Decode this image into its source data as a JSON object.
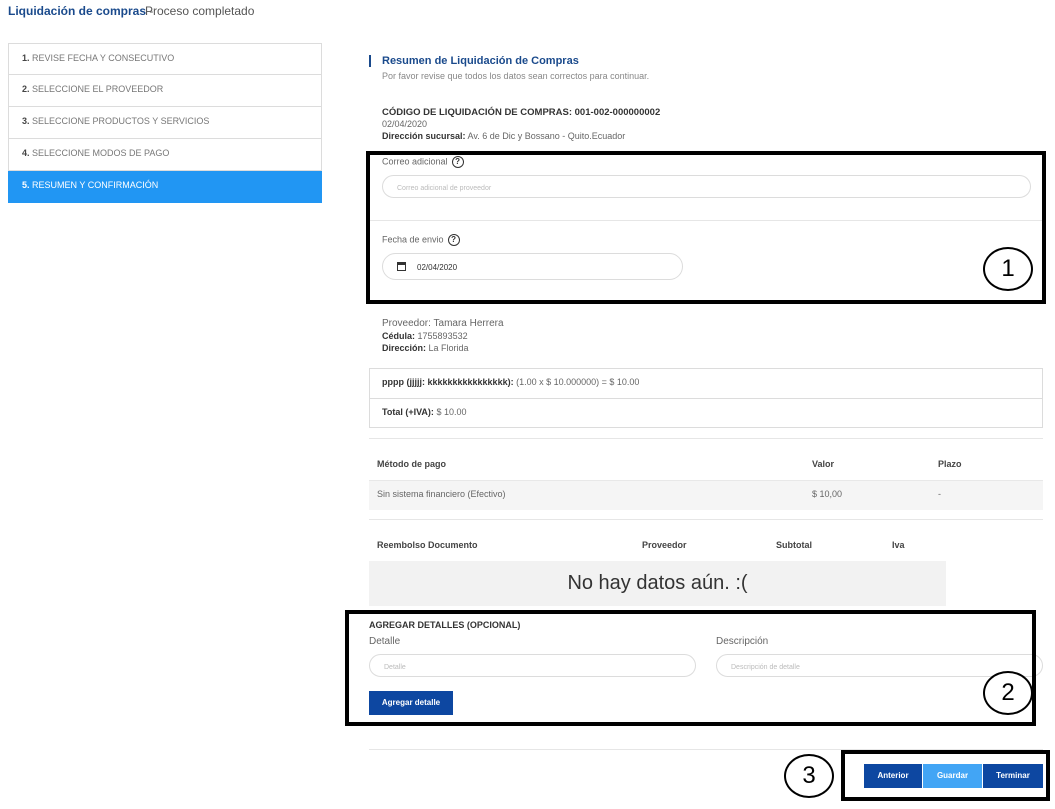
{
  "header": {
    "title": "Liquidación de compras",
    "subtitle": "Proceso completado",
    "separator": " - "
  },
  "steps": [
    {
      "num": "1.",
      "label": "REVISE FECHA Y CONSECUTIVO"
    },
    {
      "num": "2.",
      "label": "SELECCIONE EL PROVEEDOR"
    },
    {
      "num": "3.",
      "label": "SELECCIONE PRODUCTOS Y SERVICIOS"
    },
    {
      "num": "4.",
      "label": "SELECCIONE MODOS DE PAGO"
    },
    {
      "num": "5.",
      "label": "RESUMEN Y CONFIRMACIÓN",
      "active": true
    }
  ],
  "summary": {
    "title": "Resumen de Liquidación de Compras",
    "subtitle": "Por favor revise que todos los datos sean correctos para continuar.",
    "code": "CÓDIGO DE LIQUIDACIÓN DE COMPRAS: 001-002-000000002",
    "date": "02/04/2020",
    "branch_label": "Dirección sucursal:",
    "branch_value": "Av. 6 de Dic y Bossano - Quito.Ecuador"
  },
  "email": {
    "label": "Correo adicional",
    "help": "?",
    "placeholder": "Correo adicional de proveedor"
  },
  "send_date": {
    "label": "Fecha de envio",
    "help": "?",
    "value": "02/04/2020"
  },
  "provider": {
    "name_line": "Proveedor: Tamara Herrera",
    "id_label": "Cédula:",
    "id_value": "1755893532",
    "address_label": "Dirección:",
    "address_value": "La Florida"
  },
  "items": {
    "line_label": "pppp (jjjjj: kkkkkkkkkkkkkkkk):",
    "line_value": "(1.00 x $ 10.000000) = $ 10.00",
    "total_label": "Total (+IVA):",
    "total_value": "$ 10.00"
  },
  "payments": {
    "headers": [
      "Método de pago",
      "Valor",
      "Plazo"
    ],
    "rows": [
      [
        "Sin sistema financiero (Efectivo)",
        "$ 10,00",
        "-"
      ]
    ]
  },
  "reimbursement": {
    "headers": [
      "Reembolso Documento",
      "Proveedor",
      "Subtotal",
      "Iva"
    ],
    "empty": "No hay datos aún. :("
  },
  "details": {
    "title": "AGREGAR DETALLES (OPCIONAL)",
    "detail_label": "Detalle",
    "detail_placeholder": "Detalle",
    "desc_label": "Descripción",
    "desc_placeholder": "Descripción de detalle",
    "add_button": "Agregar detalle"
  },
  "nav": {
    "prev": "Anterior",
    "save": "Guardar",
    "finish": "Terminar"
  },
  "callouts": [
    "1",
    "2",
    "3"
  ],
  "colors": {
    "brand": "#1a4a8c",
    "active_step": "#2196f3",
    "button_dark": "#0d47a1",
    "button_light": "#42a5f5"
  }
}
